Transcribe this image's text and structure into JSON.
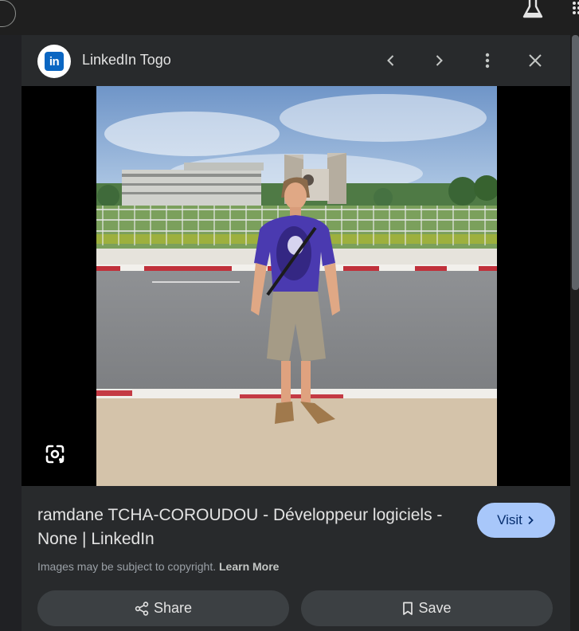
{
  "header": {
    "source_name": "LinkedIn Togo",
    "logo_text": "in"
  },
  "icons": {
    "prev": "chevron-left-icon",
    "next": "chevron-right-icon",
    "more": "more-vert-icon",
    "close": "close-icon",
    "lens": "google-lens-icon",
    "share": "share-icon",
    "save": "bookmark-icon",
    "labs": "flask-icon",
    "apps": "apps-grid-icon"
  },
  "result": {
    "title": "ramdane TCHA-COROUDOU - Développeur logiciels - None | LinkedIn",
    "visit_label": "Visit",
    "copyright_text": "Images may be subject to copyright.",
    "learn_more_label": "Learn More"
  },
  "actions": {
    "share_label": "Share",
    "save_label": "Save"
  },
  "colors": {
    "panel_bg": "#282a2c",
    "accent": "#a8c7fa",
    "linkedin_blue": "#0a66c2",
    "button_bg": "#3c4043"
  }
}
